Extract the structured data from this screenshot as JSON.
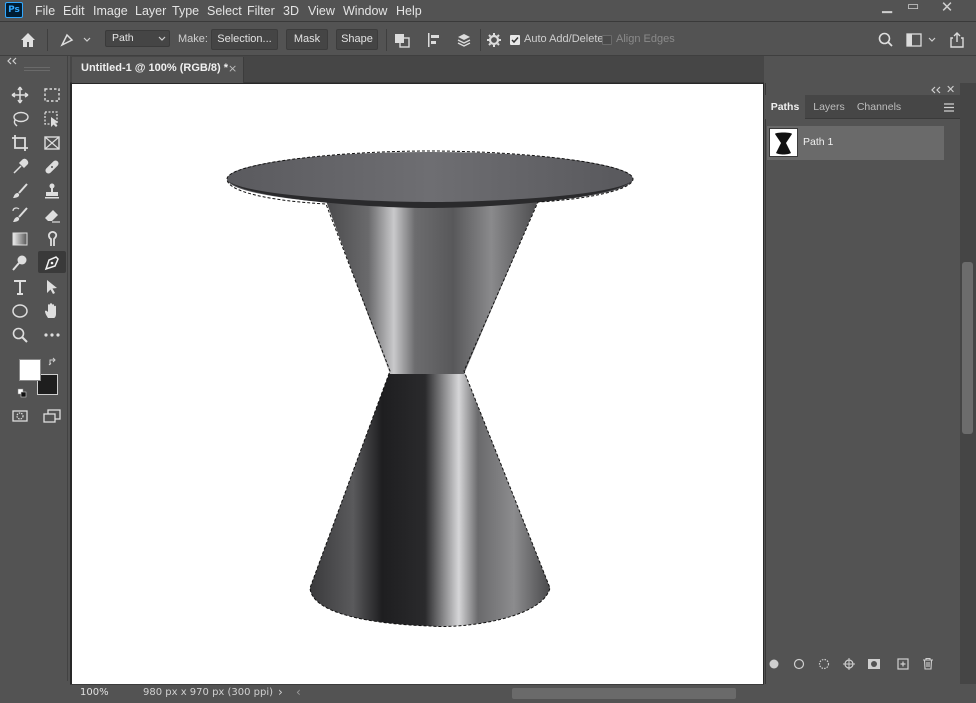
{
  "app": {
    "logo_text": "Ps",
    "menu": [
      "File",
      "Edit",
      "Image",
      "Layer",
      "Type",
      "Select",
      "Filter",
      "3D",
      "View",
      "Window",
      "Help"
    ],
    "window_controls": [
      "minimize-icon",
      "restore-icon",
      "close-icon"
    ]
  },
  "options_bar": {
    "tool_mode_value": "Path",
    "make_label": "Make:",
    "selection_button": "Selection...",
    "mask_button": "Mask",
    "shape_button": "Shape",
    "auto_add_delete_label": "Auto Add/Delete",
    "auto_add_delete_checked": true,
    "align_edges_label": "Align Edges",
    "align_edges_checked": false
  },
  "document": {
    "tab_title": "Untitled-1 @ 100% (RGB/8) *",
    "zoom": "100%",
    "doc_info": "980 px x 970 px (300 ppi)"
  },
  "panels": {
    "tabs": [
      "Paths",
      "Layers",
      "Channels"
    ],
    "active_tab": "Paths",
    "paths": [
      {
        "name": "Path 1"
      }
    ]
  },
  "colors": {
    "foreground": "#ffffff",
    "background": "#1e1e1e",
    "accent": "#31a8ff"
  }
}
